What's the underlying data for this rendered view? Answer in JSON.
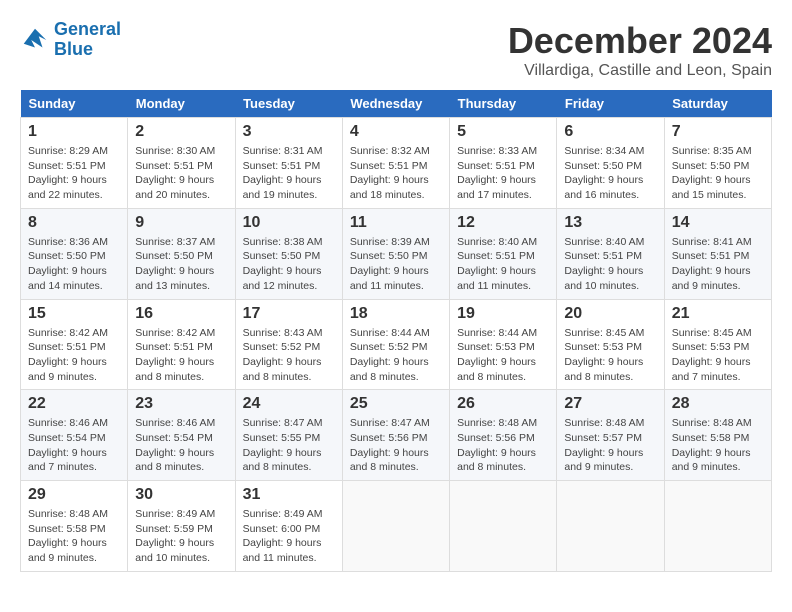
{
  "logo": {
    "line1": "General",
    "line2": "Blue"
  },
  "title": "December 2024",
  "location": "Villardiga, Castille and Leon, Spain",
  "weekdays": [
    "Sunday",
    "Monday",
    "Tuesday",
    "Wednesday",
    "Thursday",
    "Friday",
    "Saturday"
  ],
  "weeks": [
    [
      {
        "day": 1,
        "sunrise": "8:29 AM",
        "sunset": "5:51 PM",
        "daylight": "9 hours and 22 minutes."
      },
      {
        "day": 2,
        "sunrise": "8:30 AM",
        "sunset": "5:51 PM",
        "daylight": "9 hours and 20 minutes."
      },
      {
        "day": 3,
        "sunrise": "8:31 AM",
        "sunset": "5:51 PM",
        "daylight": "9 hours and 19 minutes."
      },
      {
        "day": 4,
        "sunrise": "8:32 AM",
        "sunset": "5:51 PM",
        "daylight": "9 hours and 18 minutes."
      },
      {
        "day": 5,
        "sunrise": "8:33 AM",
        "sunset": "5:51 PM",
        "daylight": "9 hours and 17 minutes."
      },
      {
        "day": 6,
        "sunrise": "8:34 AM",
        "sunset": "5:50 PM",
        "daylight": "9 hours and 16 minutes."
      },
      {
        "day": 7,
        "sunrise": "8:35 AM",
        "sunset": "5:50 PM",
        "daylight": "9 hours and 15 minutes."
      }
    ],
    [
      {
        "day": 8,
        "sunrise": "8:36 AM",
        "sunset": "5:50 PM",
        "daylight": "9 hours and 14 minutes."
      },
      {
        "day": 9,
        "sunrise": "8:37 AM",
        "sunset": "5:50 PM",
        "daylight": "9 hours and 13 minutes."
      },
      {
        "day": 10,
        "sunrise": "8:38 AM",
        "sunset": "5:50 PM",
        "daylight": "9 hours and 12 minutes."
      },
      {
        "day": 11,
        "sunrise": "8:39 AM",
        "sunset": "5:50 PM",
        "daylight": "9 hours and 11 minutes."
      },
      {
        "day": 12,
        "sunrise": "8:40 AM",
        "sunset": "5:51 PM",
        "daylight": "9 hours and 11 minutes."
      },
      {
        "day": 13,
        "sunrise": "8:40 AM",
        "sunset": "5:51 PM",
        "daylight": "9 hours and 10 minutes."
      },
      {
        "day": 14,
        "sunrise": "8:41 AM",
        "sunset": "5:51 PM",
        "daylight": "9 hours and 9 minutes."
      }
    ],
    [
      {
        "day": 15,
        "sunrise": "8:42 AM",
        "sunset": "5:51 PM",
        "daylight": "9 hours and 9 minutes."
      },
      {
        "day": 16,
        "sunrise": "8:42 AM",
        "sunset": "5:51 PM",
        "daylight": "9 hours and 8 minutes."
      },
      {
        "day": 17,
        "sunrise": "8:43 AM",
        "sunset": "5:52 PM",
        "daylight": "9 hours and 8 minutes."
      },
      {
        "day": 18,
        "sunrise": "8:44 AM",
        "sunset": "5:52 PM",
        "daylight": "9 hours and 8 minutes."
      },
      {
        "day": 19,
        "sunrise": "8:44 AM",
        "sunset": "5:53 PM",
        "daylight": "9 hours and 8 minutes."
      },
      {
        "day": 20,
        "sunrise": "8:45 AM",
        "sunset": "5:53 PM",
        "daylight": "9 hours and 8 minutes."
      },
      {
        "day": 21,
        "sunrise": "8:45 AM",
        "sunset": "5:53 PM",
        "daylight": "9 hours and 7 minutes."
      }
    ],
    [
      {
        "day": 22,
        "sunrise": "8:46 AM",
        "sunset": "5:54 PM",
        "daylight": "9 hours and 7 minutes."
      },
      {
        "day": 23,
        "sunrise": "8:46 AM",
        "sunset": "5:54 PM",
        "daylight": "9 hours and 8 minutes."
      },
      {
        "day": 24,
        "sunrise": "8:47 AM",
        "sunset": "5:55 PM",
        "daylight": "9 hours and 8 minutes."
      },
      {
        "day": 25,
        "sunrise": "8:47 AM",
        "sunset": "5:56 PM",
        "daylight": "9 hours and 8 minutes."
      },
      {
        "day": 26,
        "sunrise": "8:48 AM",
        "sunset": "5:56 PM",
        "daylight": "9 hours and 8 minutes."
      },
      {
        "day": 27,
        "sunrise": "8:48 AM",
        "sunset": "5:57 PM",
        "daylight": "9 hours and 9 minutes."
      },
      {
        "day": 28,
        "sunrise": "8:48 AM",
        "sunset": "5:58 PM",
        "daylight": "9 hours and 9 minutes."
      }
    ],
    [
      {
        "day": 29,
        "sunrise": "8:48 AM",
        "sunset": "5:58 PM",
        "daylight": "9 hours and 9 minutes."
      },
      {
        "day": 30,
        "sunrise": "8:49 AM",
        "sunset": "5:59 PM",
        "daylight": "9 hours and 10 minutes."
      },
      {
        "day": 31,
        "sunrise": "8:49 AM",
        "sunset": "6:00 PM",
        "daylight": "9 hours and 11 minutes."
      },
      null,
      null,
      null,
      null
    ]
  ]
}
